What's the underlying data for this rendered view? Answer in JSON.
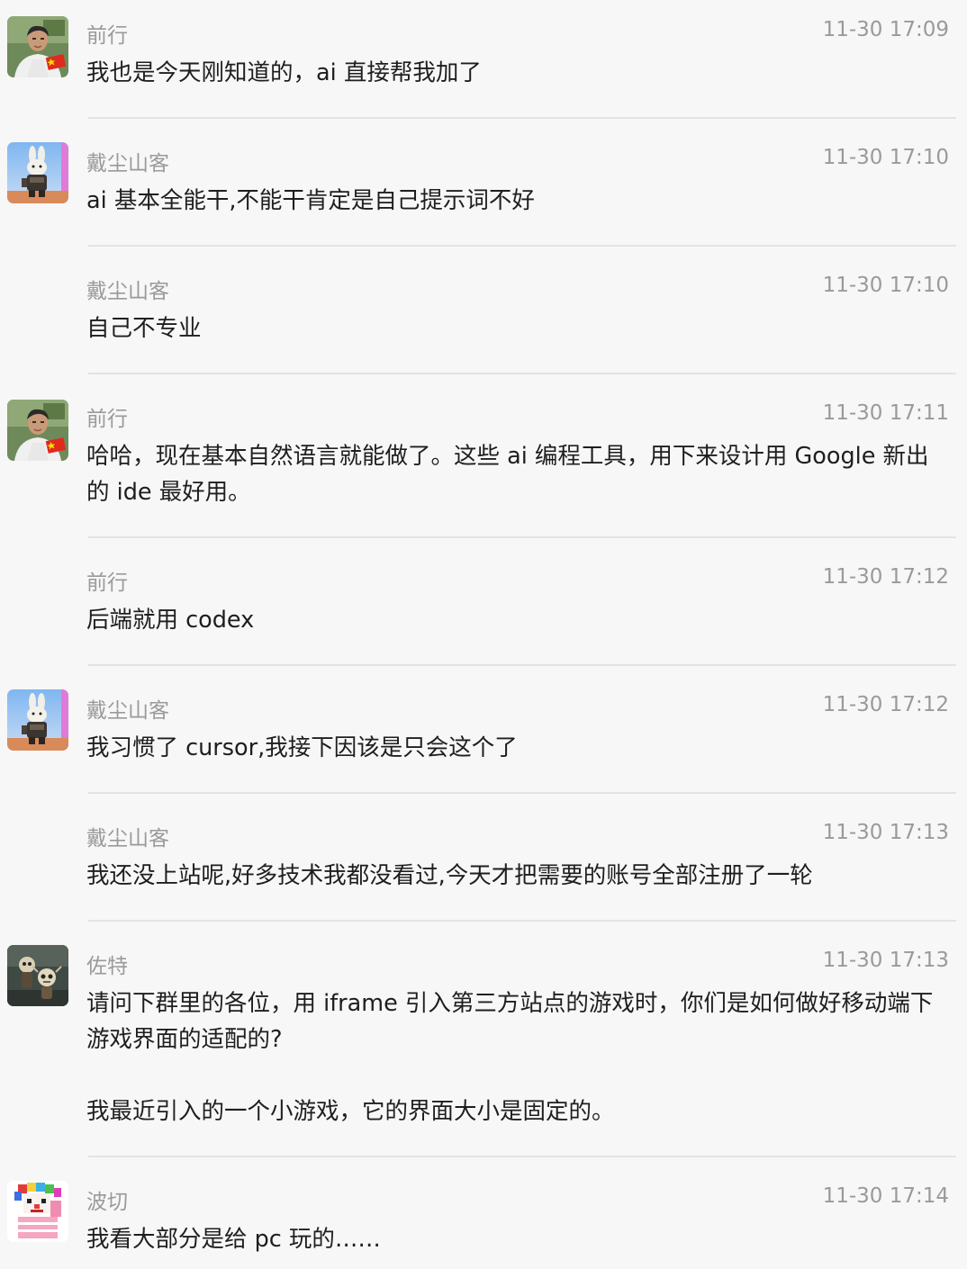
{
  "messages": [
    {
      "sender": "前行",
      "time": "11-30 17:09",
      "text": "我也是今天刚知道的，ai 直接帮我加了",
      "avatar": "man-with-flag-avatar"
    },
    {
      "sender": "戴尘山客",
      "time": "11-30 17:10",
      "text": "ai 基本全能干,不能干肯定是自己提示词不好",
      "avatar": "armored-rabbit-avatar"
    },
    {
      "sender": "戴尘山客",
      "time": "11-30 17:10",
      "text": "自己不专业",
      "avatar": ""
    },
    {
      "sender": "前行",
      "time": "11-30 17:11",
      "text": "哈哈，现在基本自然语言就能做了。这些 ai 编程工具，用下来设计用 Google 新出的 ide 最好用。",
      "avatar": "man-with-flag-avatar"
    },
    {
      "sender": "前行",
      "time": "11-30 17:12",
      "text": "后端就用 codex",
      "avatar": ""
    },
    {
      "sender": "戴尘山客",
      "time": "11-30 17:12",
      "text": "我习惯了 cursor,我接下因该是只会这个了",
      "avatar": "armored-rabbit-avatar"
    },
    {
      "sender": "戴尘山客",
      "time": "11-30 17:13",
      "text": "我还没上站呢,好多技术我都没看过,今天才把需要的账号全部注册了一轮",
      "avatar": ""
    },
    {
      "sender": "佐特",
      "time": "11-30 17:13",
      "text": "请问下群里的各位，用 iframe 引入第三方站点的游戏时，你们是如何做好移动端下游戏界面的适配的?\n\n我最近引入的一个小游戏，它的界面大小是固定的。",
      "avatar": "skull-figures-avatar"
    },
    {
      "sender": "波切",
      "time": "11-30 17:14",
      "text": "我看大部分是给 pc 玩的……",
      "avatar": "pixel-clown-avatar"
    }
  ]
}
